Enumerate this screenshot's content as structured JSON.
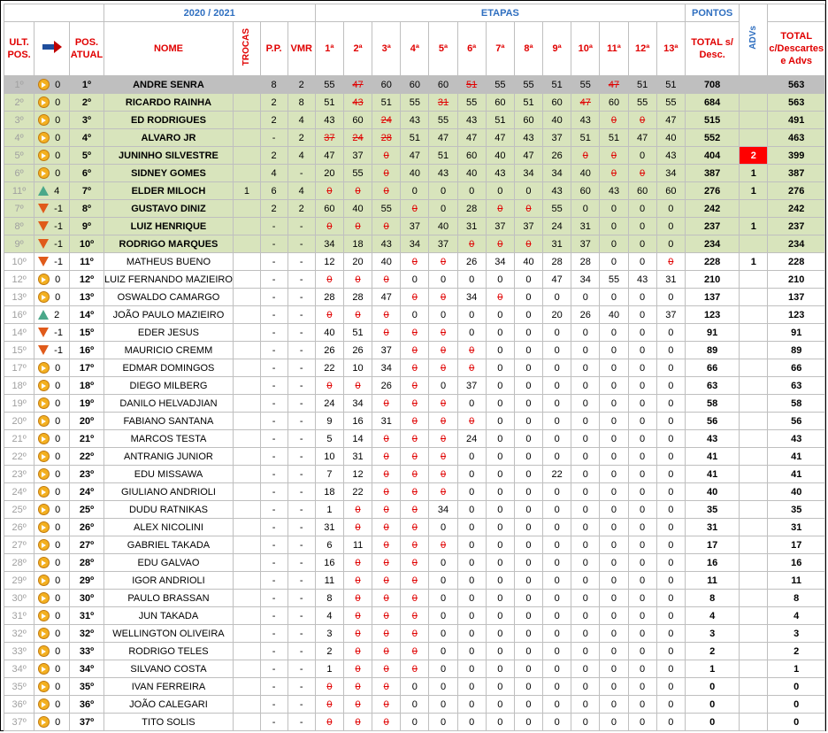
{
  "header": {
    "season": "2020 / 2021",
    "etapas": "ETAPAS",
    "pontos": "PONTOS",
    "ult_pos": "ULT. POS.",
    "pos_atual": "POS. ATUAL",
    "nome": "NOME",
    "trocas": "TROCAS",
    "pp": "P.P.",
    "vmr": "VMR",
    "stages": [
      "1ª",
      "2ª",
      "3ª",
      "4ª",
      "5ª",
      "6ª",
      "7ª",
      "8ª",
      "9ª",
      "10ª",
      "11ª",
      "12ª",
      "13ª"
    ],
    "total_desc": "TOTAL s/ Desc.",
    "advs": "ADVs",
    "total_final": "TOTAL c/Descartes e Advs"
  },
  "colors": {
    "header_blue": "#2f6fc0",
    "red": "#e00000",
    "grey_row": "#bfbfbf",
    "green_row": "#d8e4bc",
    "adv_red": "#ff0000"
  },
  "rows": [
    {
      "ult": "1º",
      "mov": "same",
      "delta": "0",
      "pos": "1º",
      "name": "ANDRE SENRA",
      "trocas": "",
      "pp": "8",
      "vmr": "2",
      "stages": [
        "55",
        "47",
        "60",
        "60",
        "60",
        "51",
        "55",
        "55",
        "51",
        "55",
        "47",
        "51",
        "51"
      ],
      "strike": [
        1,
        5,
        10
      ],
      "total": "708",
      "adv": "",
      "final": "563",
      "style": "grey"
    },
    {
      "ult": "2º",
      "mov": "same",
      "delta": "0",
      "pos": "2º",
      "name": "RICARDO RAINHA",
      "trocas": "",
      "pp": "2",
      "vmr": "8",
      "stages": [
        "51",
        "43",
        "51",
        "55",
        "31",
        "55",
        "60",
        "51",
        "60",
        "47",
        "60",
        "55",
        "55"
      ],
      "strike": [
        1,
        4,
        9
      ],
      "total": "684",
      "adv": "",
      "final": "563",
      "style": "green"
    },
    {
      "ult": "3º",
      "mov": "same",
      "delta": "0",
      "pos": "3º",
      "name": "ED RODRIGUES",
      "trocas": "",
      "pp": "2",
      "vmr": "4",
      "stages": [
        "43",
        "60",
        "24",
        "43",
        "55",
        "43",
        "51",
        "60",
        "40",
        "43",
        "0",
        "0",
        "47"
      ],
      "strike": [
        2,
        10,
        11
      ],
      "total": "515",
      "adv": "",
      "final": "491",
      "style": "green"
    },
    {
      "ult": "4º",
      "mov": "same",
      "delta": "0",
      "pos": "4º",
      "name": "ALVARO JR",
      "trocas": "",
      "pp": "-",
      "vmr": "2",
      "stages": [
        "37",
        "24",
        "28",
        "51",
        "47",
        "47",
        "47",
        "43",
        "37",
        "51",
        "51",
        "47",
        "40"
      ],
      "strike": [
        0,
        1,
        2
      ],
      "total": "552",
      "adv": "",
      "final": "463",
      "style": "green"
    },
    {
      "ult": "5º",
      "mov": "same",
      "delta": "0",
      "pos": "5º",
      "name": "JUNINHO SILVESTRE",
      "trocas": "",
      "pp": "2",
      "vmr": "4",
      "stages": [
        "47",
        "37",
        "0",
        "47",
        "51",
        "60",
        "40",
        "47",
        "26",
        "0",
        "0",
        "0",
        "43"
      ],
      "strike": [
        2,
        9,
        10
      ],
      "total": "404",
      "adv": "2",
      "adv_red": true,
      "final": "399",
      "style": "green"
    },
    {
      "ult": "6º",
      "mov": "same",
      "delta": "0",
      "pos": "6º",
      "name": "SIDNEY GOMES",
      "trocas": "",
      "pp": "4",
      "vmr": "-",
      "stages": [
        "20",
        "55",
        "0",
        "40",
        "43",
        "40",
        "43",
        "34",
        "34",
        "40",
        "0",
        "0",
        "34"
      ],
      "strike": [
        2,
        10,
        11
      ],
      "total": "387",
      "adv": "1",
      "final": "387",
      "style": "green"
    },
    {
      "ult": "11º",
      "mov": "up",
      "delta": "4",
      "pos": "7º",
      "name": "ELDER MILOCH",
      "trocas": "1",
      "pp": "6",
      "vmr": "4",
      "stages": [
        "0",
        "0",
        "0",
        "0",
        "0",
        "0",
        "0",
        "0",
        "43",
        "60",
        "43",
        "60",
        "60"
      ],
      "strike": [
        0,
        1,
        2
      ],
      "total": "276",
      "adv": "1",
      "final": "276",
      "style": "green"
    },
    {
      "ult": "7º",
      "mov": "down",
      "delta": "-1",
      "pos": "8º",
      "name": "GUSTAVO DINIZ",
      "trocas": "",
      "pp": "2",
      "vmr": "2",
      "stages": [
        "60",
        "40",
        "55",
        "0",
        "0",
        "28",
        "0",
        "0",
        "55",
        "0",
        "0",
        "0",
        "0"
      ],
      "strike": [
        3,
        6,
        7
      ],
      "total": "242",
      "adv": "",
      "final": "242",
      "style": "green"
    },
    {
      "ult": "8º",
      "mov": "down",
      "delta": "-1",
      "pos": "9º",
      "name": "LUIZ HENRIQUE",
      "trocas": "",
      "pp": "-",
      "vmr": "-",
      "stages": [
        "0",
        "0",
        "0",
        "37",
        "40",
        "31",
        "37",
        "37",
        "24",
        "31",
        "0",
        "0",
        "0"
      ],
      "strike": [
        0,
        1,
        2
      ],
      "total": "237",
      "adv": "1",
      "final": "237",
      "style": "green"
    },
    {
      "ult": "9º",
      "mov": "down",
      "delta": "-1",
      "pos": "10º",
      "name": "RODRIGO MARQUES",
      "trocas": "",
      "pp": "-",
      "vmr": "-",
      "stages": [
        "34",
        "18",
        "43",
        "34",
        "37",
        "0",
        "0",
        "0",
        "31",
        "37",
        "0",
        "0",
        "0"
      ],
      "strike": [
        5,
        6,
        7
      ],
      "total": "234",
      "adv": "",
      "final": "234",
      "style": "green"
    },
    {
      "ult": "10º",
      "mov": "down",
      "delta": "-1",
      "pos": "11º",
      "name": "MATHEUS BUENO",
      "trocas": "",
      "pp": "-",
      "vmr": "-",
      "stages": [
        "12",
        "20",
        "40",
        "0",
        "0",
        "26",
        "34",
        "40",
        "28",
        "28",
        "0",
        "0",
        "0"
      ],
      "strike": [
        3,
        4,
        12
      ],
      "total": "228",
      "adv": "1",
      "final": "228",
      "style": ""
    },
    {
      "ult": "12º",
      "mov": "same",
      "delta": "0",
      "pos": "12º",
      "name": "LUIZ FERNANDO MAZIEIRO",
      "trocas": "",
      "pp": "-",
      "vmr": "-",
      "stages": [
        "0",
        "0",
        "0",
        "0",
        "0",
        "0",
        "0",
        "0",
        "47",
        "34",
        "55",
        "43",
        "31"
      ],
      "strike": [
        0,
        1,
        2
      ],
      "total": "210",
      "adv": "",
      "final": "210",
      "style": ""
    },
    {
      "ult": "13º",
      "mov": "same",
      "delta": "0",
      "pos": "13º",
      "name": "OSWALDO CAMARGO",
      "trocas": "",
      "pp": "-",
      "vmr": "-",
      "stages": [
        "28",
        "28",
        "47",
        "0",
        "0",
        "34",
        "0",
        "0",
        "0",
        "0",
        "0",
        "0",
        "0"
      ],
      "strike": [
        3,
        4,
        6
      ],
      "total": "137",
      "adv": "",
      "final": "137",
      "style": ""
    },
    {
      "ult": "16º",
      "mov": "up",
      "delta": "2",
      "pos": "14º",
      "name": "JOÃO PAULO MAZIEIRO",
      "trocas": "",
      "pp": "-",
      "vmr": "-",
      "stages": [
        "0",
        "0",
        "0",
        "0",
        "0",
        "0",
        "0",
        "0",
        "20",
        "26",
        "40",
        "0",
        "37"
      ],
      "strike": [
        0,
        1,
        2
      ],
      "total": "123",
      "adv": "",
      "final": "123",
      "style": ""
    },
    {
      "ult": "14º",
      "mov": "down",
      "delta": "-1",
      "pos": "15º",
      "name": "EDER JESUS",
      "trocas": "",
      "pp": "-",
      "vmr": "-",
      "stages": [
        "40",
        "51",
        "0",
        "0",
        "0",
        "0",
        "0",
        "0",
        "0",
        "0",
        "0",
        "0",
        "0"
      ],
      "strike": [
        2,
        3,
        4
      ],
      "total": "91",
      "adv": "",
      "final": "91",
      "style": ""
    },
    {
      "ult": "15º",
      "mov": "down",
      "delta": "-1",
      "pos": "16º",
      "name": "MAURICIO CREMM",
      "trocas": "",
      "pp": "-",
      "vmr": "-",
      "stages": [
        "26",
        "26",
        "37",
        "0",
        "0",
        "0",
        "0",
        "0",
        "0",
        "0",
        "0",
        "0",
        "0"
      ],
      "strike": [
        3,
        4,
        5
      ],
      "total": "89",
      "adv": "",
      "final": "89",
      "style": ""
    },
    {
      "ult": "17º",
      "mov": "same",
      "delta": "0",
      "pos": "17º",
      "name": "EDMAR DOMINGOS",
      "trocas": "",
      "pp": "-",
      "vmr": "-",
      "stages": [
        "22",
        "10",
        "34",
        "0",
        "0",
        "0",
        "0",
        "0",
        "0",
        "0",
        "0",
        "0",
        "0"
      ],
      "strike": [
        3,
        4,
        5
      ],
      "total": "66",
      "adv": "",
      "final": "66",
      "style": ""
    },
    {
      "ult": "18º",
      "mov": "same",
      "delta": "0",
      "pos": "18º",
      "name": "DIEGO MILBERG",
      "trocas": "",
      "pp": "-",
      "vmr": "-",
      "stages": [
        "0",
        "0",
        "26",
        "0",
        "0",
        "37",
        "0",
        "0",
        "0",
        "0",
        "0",
        "0",
        "0"
      ],
      "strike": [
        0,
        1,
        3
      ],
      "total": "63",
      "adv": "",
      "final": "63",
      "style": ""
    },
    {
      "ult": "19º",
      "mov": "same",
      "delta": "0",
      "pos": "19º",
      "name": "DANILO HELVADJIAN",
      "trocas": "",
      "pp": "-",
      "vmr": "-",
      "stages": [
        "24",
        "34",
        "0",
        "0",
        "0",
        "0",
        "0",
        "0",
        "0",
        "0",
        "0",
        "0",
        "0"
      ],
      "strike": [
        2,
        3,
        4
      ],
      "total": "58",
      "adv": "",
      "final": "58",
      "style": ""
    },
    {
      "ult": "20º",
      "mov": "same",
      "delta": "0",
      "pos": "20º",
      "name": "FABIANO SANTANA",
      "trocas": "",
      "pp": "-",
      "vmr": "-",
      "stages": [
        "9",
        "16",
        "31",
        "0",
        "0",
        "0",
        "0",
        "0",
        "0",
        "0",
        "0",
        "0",
        "0"
      ],
      "strike": [
        3,
        4,
        5
      ],
      "total": "56",
      "adv": "",
      "final": "56",
      "style": ""
    },
    {
      "ult": "21º",
      "mov": "same",
      "delta": "0",
      "pos": "21º",
      "name": "MARCOS TESTA",
      "trocas": "",
      "pp": "-",
      "vmr": "-",
      "stages": [
        "5",
        "14",
        "0",
        "0",
        "0",
        "24",
        "0",
        "0",
        "0",
        "0",
        "0",
        "0",
        "0"
      ],
      "strike": [
        2,
        3,
        4
      ],
      "total": "43",
      "adv": "",
      "final": "43",
      "style": ""
    },
    {
      "ult": "22º",
      "mov": "same",
      "delta": "0",
      "pos": "22º",
      "name": "ANTRANIG JUNIOR",
      "trocas": "",
      "pp": "-",
      "vmr": "-",
      "stages": [
        "10",
        "31",
        "0",
        "0",
        "0",
        "0",
        "0",
        "0",
        "0",
        "0",
        "0",
        "0",
        "0"
      ],
      "strike": [
        2,
        3,
        4
      ],
      "total": "41",
      "adv": "",
      "final": "41",
      "style": ""
    },
    {
      "ult": "23º",
      "mov": "same",
      "delta": "0",
      "pos": "23º",
      "name": "EDU MISSAWA",
      "trocas": "",
      "pp": "-",
      "vmr": "-",
      "stages": [
        "7",
        "12",
        "0",
        "0",
        "0",
        "0",
        "0",
        "0",
        "22",
        "0",
        "0",
        "0",
        "0"
      ],
      "strike": [
        2,
        3,
        4
      ],
      "total": "41",
      "adv": "",
      "final": "41",
      "style": ""
    },
    {
      "ult": "24º",
      "mov": "same",
      "delta": "0",
      "pos": "24º",
      "name": "GIULIANO ANDRIOLI",
      "trocas": "",
      "pp": "-",
      "vmr": "-",
      "stages": [
        "18",
        "22",
        "0",
        "0",
        "0",
        "0",
        "0",
        "0",
        "0",
        "0",
        "0",
        "0",
        "0"
      ],
      "strike": [
        2,
        3,
        4
      ],
      "total": "40",
      "adv": "",
      "final": "40",
      "style": ""
    },
    {
      "ult": "25º",
      "mov": "same",
      "delta": "0",
      "pos": "25º",
      "name": "DUDU RATNIKAS",
      "trocas": "",
      "pp": "-",
      "vmr": "-",
      "stages": [
        "1",
        "0",
        "0",
        "0",
        "34",
        "0",
        "0",
        "0",
        "0",
        "0",
        "0",
        "0",
        "0"
      ],
      "strike": [
        1,
        2,
        3
      ],
      "total": "35",
      "adv": "",
      "final": "35",
      "style": ""
    },
    {
      "ult": "26º",
      "mov": "same",
      "delta": "0",
      "pos": "26º",
      "name": "ALEX NICOLINI",
      "trocas": "",
      "pp": "-",
      "vmr": "-",
      "stages": [
        "31",
        "0",
        "0",
        "0",
        "0",
        "0",
        "0",
        "0",
        "0",
        "0",
        "0",
        "0",
        "0"
      ],
      "strike": [
        1,
        2,
        3
      ],
      "total": "31",
      "adv": "",
      "final": "31",
      "style": ""
    },
    {
      "ult": "27º",
      "mov": "same",
      "delta": "0",
      "pos": "27º",
      "name": "GABRIEL TAKADA",
      "trocas": "",
      "pp": "-",
      "vmr": "-",
      "stages": [
        "6",
        "11",
        "0",
        "0",
        "0",
        "0",
        "0",
        "0",
        "0",
        "0",
        "0",
        "0",
        "0"
      ],
      "strike": [
        2,
        3,
        4
      ],
      "total": "17",
      "adv": "",
      "final": "17",
      "style": ""
    },
    {
      "ult": "28º",
      "mov": "same",
      "delta": "0",
      "pos": "28º",
      "name": "EDU GALVAO",
      "trocas": "",
      "pp": "-",
      "vmr": "-",
      "stages": [
        "16",
        "0",
        "0",
        "0",
        "0",
        "0",
        "0",
        "0",
        "0",
        "0",
        "0",
        "0",
        "0"
      ],
      "strike": [
        1,
        2,
        3
      ],
      "total": "16",
      "adv": "",
      "final": "16",
      "style": ""
    },
    {
      "ult": "29º",
      "mov": "same",
      "delta": "0",
      "pos": "29º",
      "name": "IGOR ANDRIOLI",
      "trocas": "",
      "pp": "-",
      "vmr": "-",
      "stages": [
        "11",
        "0",
        "0",
        "0",
        "0",
        "0",
        "0",
        "0",
        "0",
        "0",
        "0",
        "0",
        "0"
      ],
      "strike": [
        1,
        2,
        3
      ],
      "total": "11",
      "adv": "",
      "final": "11",
      "style": ""
    },
    {
      "ult": "30º",
      "mov": "same",
      "delta": "0",
      "pos": "30º",
      "name": "PAULO BRASSAN",
      "trocas": "",
      "pp": "-",
      "vmr": "-",
      "stages": [
        "8",
        "0",
        "0",
        "0",
        "0",
        "0",
        "0",
        "0",
        "0",
        "0",
        "0",
        "0",
        "0"
      ],
      "strike": [
        1,
        2,
        3
      ],
      "total": "8",
      "adv": "",
      "final": "8",
      "style": ""
    },
    {
      "ult": "31º",
      "mov": "same",
      "delta": "0",
      "pos": "31º",
      "name": "JUN TAKADA",
      "trocas": "",
      "pp": "-",
      "vmr": "-",
      "stages": [
        "4",
        "0",
        "0",
        "0",
        "0",
        "0",
        "0",
        "0",
        "0",
        "0",
        "0",
        "0",
        "0"
      ],
      "strike": [
        1,
        2,
        3
      ],
      "total": "4",
      "adv": "",
      "final": "4",
      "style": ""
    },
    {
      "ult": "32º",
      "mov": "same",
      "delta": "0",
      "pos": "32º",
      "name": "WELLINGTON OLIVEIRA",
      "trocas": "",
      "pp": "-",
      "vmr": "-",
      "stages": [
        "3",
        "0",
        "0",
        "0",
        "0",
        "0",
        "0",
        "0",
        "0",
        "0",
        "0",
        "0",
        "0"
      ],
      "strike": [
        1,
        2,
        3
      ],
      "total": "3",
      "adv": "",
      "final": "3",
      "style": ""
    },
    {
      "ult": "33º",
      "mov": "same",
      "delta": "0",
      "pos": "33º",
      "name": "RODRIGO TELES",
      "trocas": "",
      "pp": "-",
      "vmr": "-",
      "stages": [
        "2",
        "0",
        "0",
        "0",
        "0",
        "0",
        "0",
        "0",
        "0",
        "0",
        "0",
        "0",
        "0"
      ],
      "strike": [
        1,
        2,
        3
      ],
      "total": "2",
      "adv": "",
      "final": "2",
      "style": ""
    },
    {
      "ult": "34º",
      "mov": "same",
      "delta": "0",
      "pos": "34º",
      "name": "SILVANO COSTA",
      "trocas": "",
      "pp": "-",
      "vmr": "-",
      "stages": [
        "1",
        "0",
        "0",
        "0",
        "0",
        "0",
        "0",
        "0",
        "0",
        "0",
        "0",
        "0",
        "0"
      ],
      "strike": [
        1,
        2,
        3
      ],
      "total": "1",
      "adv": "",
      "final": "1",
      "style": ""
    },
    {
      "ult": "35º",
      "mov": "same",
      "delta": "0",
      "pos": "35º",
      "name": "IVAN FERREIRA",
      "trocas": "",
      "pp": "-",
      "vmr": "-",
      "stages": [
        "0",
        "0",
        "0",
        "0",
        "0",
        "0",
        "0",
        "0",
        "0",
        "0",
        "0",
        "0",
        "0"
      ],
      "strike": [
        0,
        1,
        2
      ],
      "total": "0",
      "adv": "",
      "final": "0",
      "style": ""
    },
    {
      "ult": "36º",
      "mov": "same",
      "delta": "0",
      "pos": "36º",
      "name": "JOÃO CALEGARI",
      "trocas": "",
      "pp": "-",
      "vmr": "-",
      "stages": [
        "0",
        "0",
        "0",
        "0",
        "0",
        "0",
        "0",
        "0",
        "0",
        "0",
        "0",
        "0",
        "0"
      ],
      "strike": [
        0,
        1,
        2
      ],
      "total": "0",
      "adv": "",
      "final": "0",
      "style": ""
    },
    {
      "ult": "37º",
      "mov": "same",
      "delta": "0",
      "pos": "37º",
      "name": "TITO SOLIS",
      "trocas": "",
      "pp": "-",
      "vmr": "-",
      "stages": [
        "0",
        "0",
        "0",
        "0",
        "0",
        "0",
        "0",
        "0",
        "0",
        "0",
        "0",
        "0",
        "0"
      ],
      "strike": [
        0,
        1,
        2
      ],
      "total": "0",
      "adv": "",
      "final": "0",
      "style": ""
    }
  ]
}
